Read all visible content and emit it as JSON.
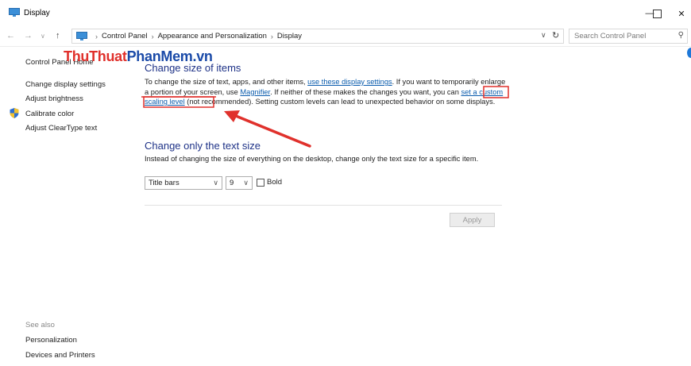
{
  "window": {
    "title": "Display"
  },
  "address": {
    "crumbs": [
      "Control Panel",
      "Appearance and Personalization",
      "Display"
    ],
    "search_placeholder": "Search Control Panel"
  },
  "sidebar": {
    "home": "Control Panel Home",
    "links": [
      "Change display settings",
      "Adjust brightness",
      "Calibrate color",
      "Adjust ClearType text"
    ],
    "see_also_title": "See also",
    "see_also": [
      "Personalization",
      "Devices and Printers"
    ]
  },
  "watermark": {
    "part1": "ThuThuat",
    "part2": "PhanMem",
    "part3": ".vn"
  },
  "size_section": {
    "title": "Change size of items",
    "text1": "To change the size of text, apps, and other items, ",
    "link1": "use these display settings",
    "text2": ".  If you want to temporarily enlarge a portion of your screen, use ",
    "link2": "Magnifier",
    "text3": ".  If neither of these makes the changes you want, you can ",
    "link3": "set a custom scaling level",
    "text4": " (not recommended).  Setting custom levels can lead to unexpected behavior on some displays."
  },
  "text_section": {
    "title": "Change only the text size",
    "description": "Instead of changing the size of everything on the desktop, change only the text size for a specific item.",
    "item_select": "Title bars",
    "size_select": "9",
    "bold_label": "Bold"
  },
  "apply_label": "Apply",
  "colors": {
    "heading": "#1e3287",
    "link": "#0b5cad",
    "annotation": "#e0312c"
  }
}
